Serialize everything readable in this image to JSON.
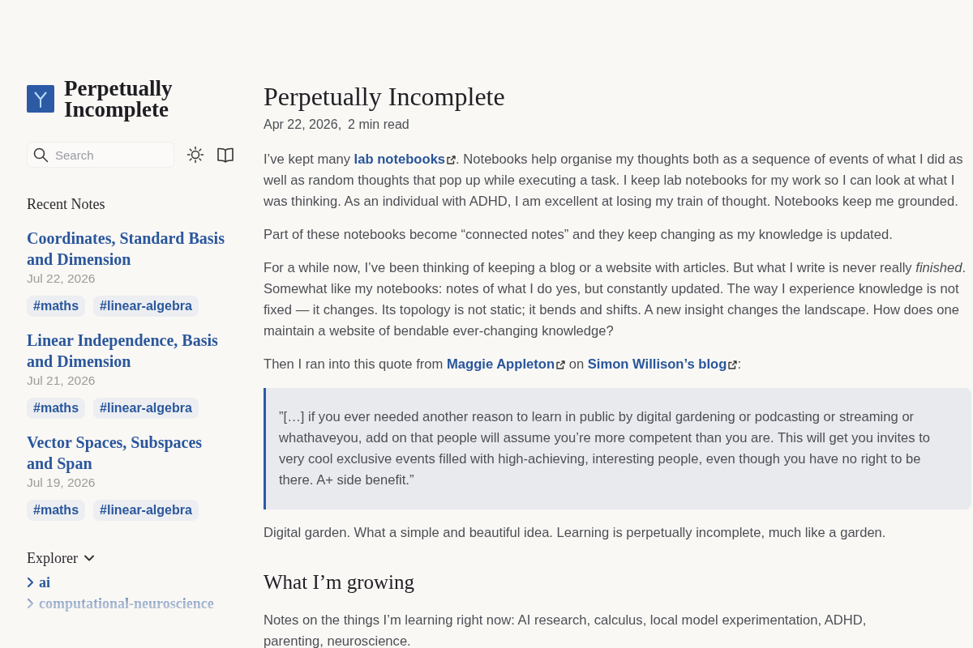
{
  "sidebar": {
    "site_title": "Perpetually Incomplete",
    "search": {
      "placeholder": "Search"
    },
    "recent_notes": {
      "heading": "Recent Notes",
      "notes": [
        {
          "title": "Coordinates, Standard Basis and Dimension",
          "date": "Jul 22, 2026",
          "tags": [
            "#maths",
            "#linear-algebra"
          ]
        },
        {
          "title": "Linear Independence, Basis and Dimension",
          "date": "Jul 21, 2026",
          "tags": [
            "#maths",
            "#linear-algebra"
          ]
        },
        {
          "title": "Vector Spaces, Subspaces and Span",
          "date": "Jul 19, 2026",
          "tags": [
            "#maths",
            "#linear-algebra"
          ]
        }
      ]
    },
    "explorer": {
      "heading": "Explorer",
      "expanded": true,
      "items": [
        {
          "label": "ai",
          "expanded": false
        },
        {
          "label": "computational-neuroscience",
          "expanded": false
        }
      ]
    }
  },
  "article": {
    "title": "Perpetually Incomplete",
    "date": "Apr 22, 2026,",
    "reading_time": "2 min read",
    "blocks": [
      {
        "kind": "paragraph",
        "parts": [
          {
            "kind": "text",
            "text": "I’ve kept many "
          },
          {
            "kind": "link",
            "text": "lab notebooks",
            "external": true
          },
          {
            "kind": "text",
            "text": ". Notebooks help organise my thoughts both as a sequence of events of what I did as well as random thoughts that pop up while executing a task. I keep lab notebooks for my work so I can look at what I was thinking. As an individual with ADHD, I am excellent at losing my train of thought. Notebooks keep me grounded."
          }
        ]
      },
      {
        "kind": "paragraph",
        "parts": [
          {
            "kind": "text",
            "text": "Part of these notebooks become “connected notes” and they keep changing as my knowledge is updated."
          }
        ]
      },
      {
        "kind": "paragraph",
        "parts": [
          {
            "kind": "text",
            "text": "For a while now, I’ve been thinking of keeping a blog or a website with articles. But what I write is never really *finished*. Somewhat like my notebooks: notes of what I do yes, but constantly updated. The way I experience knowledge is not fixed — it changes. Its topology is not static; it bends and shifts. A new insight changes the landscape. How does one maintain a website of bendable ever-changing knowledge?"
          }
        ]
      },
      {
        "kind": "paragraph",
        "parts": [
          {
            "kind": "text",
            "text": "Then I ran into this quote from "
          },
          {
            "kind": "link",
            "text": "Maggie Appleton",
            "external": true
          },
          {
            "kind": "text",
            "text": " on "
          },
          {
            "kind": "link",
            "text": "Simon Willison’s blog",
            "external": true
          },
          {
            "kind": "text",
            "text": ":"
          }
        ]
      },
      {
        "kind": "quote",
        "text": "”[…] if you ever needed another reason to learn in public by digital gardening or podcasting or streaming or whathaveyou, add on that people will assume you’re more competent than you are. This will get you invites to very cool exclusive events filled with high-achieving, interesting people, even though you have no right to be there. A+ side benefit.”"
      },
      {
        "kind": "paragraph",
        "parts": [
          {
            "kind": "text",
            "text": "Digital garden. What a simple and beautiful idea. Learning is perpetually incomplete, much like a garden."
          }
        ]
      },
      {
        "kind": "heading",
        "text": "What I’m growing"
      },
      {
        "kind": "paragraph",
        "parts": [
          {
            "kind": "text",
            "text": "Notes on the things I’m learning right now: AI research, calculus, local model experimentation, ADHD,\nparenting, neuroscience."
          }
        ]
      }
    ]
  }
}
